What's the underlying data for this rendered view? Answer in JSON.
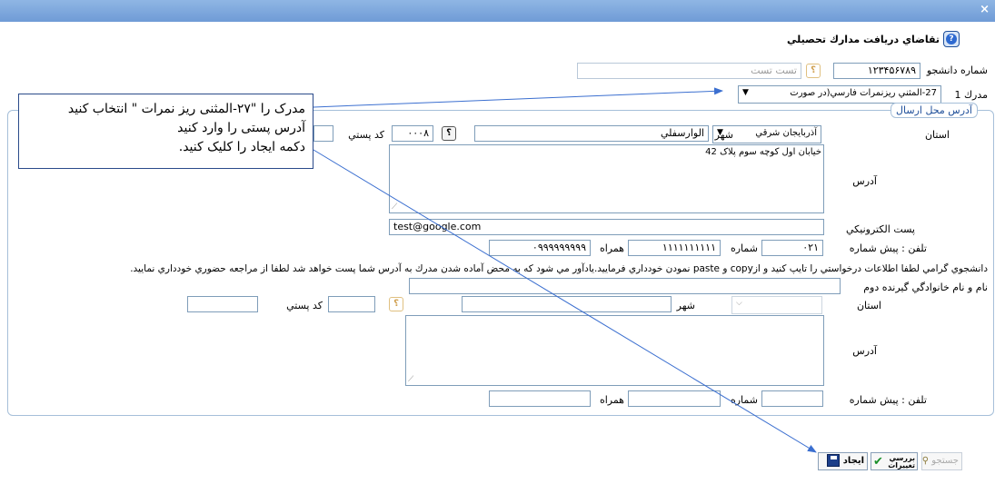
{
  "window": {
    "close_glyph": "×"
  },
  "header": {
    "title": "تقاضاي دريافت مدارك تحصيلي",
    "help_icon": "help-icon"
  },
  "student": {
    "label": "شماره دانشجو",
    "number": "۱۲۳۴۵۶۷۸۹",
    "lookup_glyph": "؟",
    "name_value": "تست تست"
  },
  "document": {
    "label": "مدرك 1",
    "selected": "27-المثني ريزنمرات فارسي(در صورت",
    "arrow": "▼"
  },
  "section": {
    "legend": "آدرس محل ارسال"
  },
  "callout": {
    "line1": "مدرک را \"۲۷-المثنی ریز نمرات \" انتخاب کنید",
    "line2": "آدرس پستی را وارد کنید",
    "line3": "دکمه ایجاد را کلیک کنید."
  },
  "address1": {
    "province_label": "استان",
    "province_value": "آذربايجان شرقي",
    "city_label": "شهر",
    "city_value": "الوارسفلي",
    "city_code": "۰۰۰۸",
    "postal_label": "كد پستي",
    "postal_value": "",
    "address_label": "آدرس",
    "address_value": "خيابان اول کوچه سوم پلاک 42",
    "email_label": "پست الكترونيكي",
    "email_value": "test@google.com",
    "phone_label": "تلفن : پيش شماره",
    "phone_prefix": "۰۲۱",
    "phone_number_label": "شماره",
    "phone_number": "۱۱۱۱۱۱۱۱۱۱",
    "mobile_label": "همراه",
    "mobile_value": "۰۹۹۹۹۹۹۹۹۹"
  },
  "notice": "دانشجوي گرامي لطفا اطلاعات درخواستي را تايپ كنيد و ازcopy و paste نمودن خودداري فرماييد.يادآور مي شود كه به محض آماده شدن مدرك به آدرس شما پست خواهد شد لطفا از مراجعه حضوري خودداري نماييد.",
  "address2": {
    "recipient_label": "نام و نام خانوادگي گيرنده دوم",
    "recipient_value": "",
    "province_label": "استان",
    "city_label": "شهر",
    "postal_label": "كد پستي",
    "address_label": "آدرس",
    "phone_label": "تلفن : پيش شماره",
    "phone_number_label": "شماره",
    "mobile_label": "همراه"
  },
  "toolbar": {
    "create_label": "ايجاد",
    "review_label": "بررسي تغييرات",
    "search_label": "جستجو"
  }
}
